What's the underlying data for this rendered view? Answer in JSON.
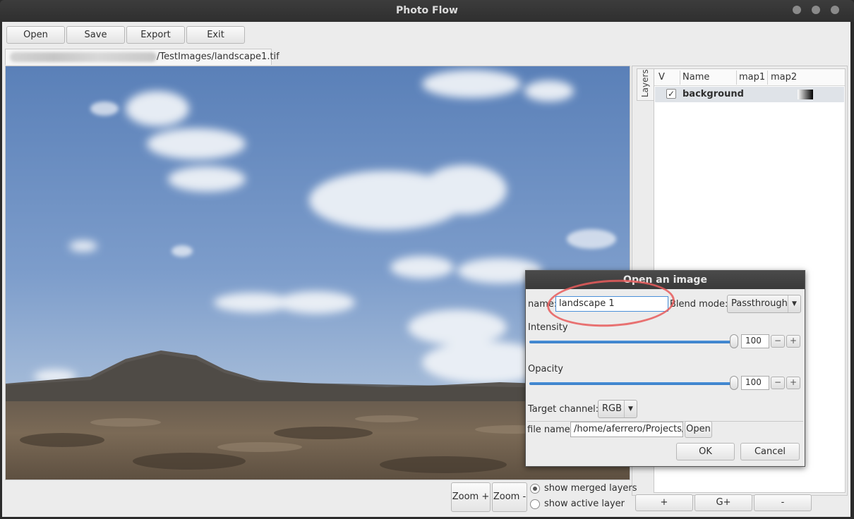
{
  "window": {
    "title": "Photo Flow"
  },
  "toolbar": {
    "open": "Open",
    "save": "Save",
    "export": "Export",
    "exit": "Exit"
  },
  "tab": {
    "path_visible": "/TestImages/landscape1.tif"
  },
  "layers": {
    "side_tab": "Layers",
    "columns": {
      "v": "V",
      "name": "Name",
      "map1": "map1",
      "map2": "map2"
    },
    "rows": [
      {
        "visible": true,
        "check": "✓",
        "name": "background"
      }
    ],
    "buttons": {
      "add": "+",
      "group": "G+",
      "remove": "-"
    }
  },
  "viewer": {
    "zoom_in": "Zoom +",
    "zoom_out": "Zoom -",
    "show_merged": "show merged layers",
    "show_active": "show active layer",
    "selected_mode": "show merged layers"
  },
  "dialog": {
    "title": "Open an image",
    "name_label": "name:",
    "name_value": "landscape 1",
    "blend_label": "Blend mode:",
    "blend_value": "Passthrough",
    "intensity_label": "Intensity",
    "intensity_value": "100",
    "intensity_fraction": 1.0,
    "opacity_label": "Opacity",
    "opacity_value": "100",
    "opacity_fraction": 1.0,
    "target_label": "Target channel:",
    "target_value": "RGB",
    "file_label": "file name:",
    "file_value": "/home/aferrero/Projects/P",
    "file_open": "Open",
    "ok": "OK",
    "cancel": "Cancel",
    "minus": "−",
    "plus": "+"
  },
  "colors": {
    "accent": "#4a90d9",
    "annotation": "#e85c5c"
  }
}
